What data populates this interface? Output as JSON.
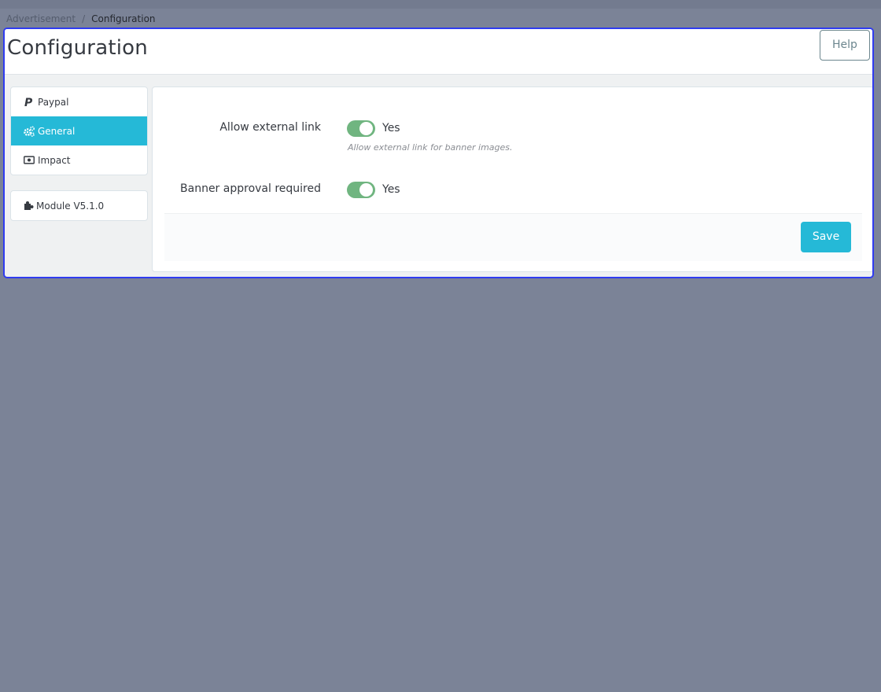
{
  "breadcrumb": {
    "parent": "Advertisement",
    "separator": "/",
    "current": "Configuration"
  },
  "header": {
    "title": "Configuration",
    "help_label": "Help"
  },
  "sidebar": {
    "items": [
      {
        "label": "Paypal",
        "icon": "paypal-icon",
        "active": false
      },
      {
        "label": "General",
        "icon": "cogs-icon",
        "active": true
      },
      {
        "label": "Impact",
        "icon": "money-bill-icon",
        "active": false
      }
    ],
    "module": {
      "label": "Module V5.1.0",
      "icon": "puzzle-icon"
    }
  },
  "form": {
    "fields": [
      {
        "label": "Allow external link",
        "value": "Yes",
        "enabled": true,
        "help": "Allow external link for banner images."
      },
      {
        "label": "Banner approval required",
        "value": "Yes",
        "enabled": true
      }
    ],
    "save_label": "Save"
  },
  "colors": {
    "accent": "#25b9d7",
    "switch_on": "#70b580",
    "frame_border": "#2f3bf0",
    "background": "#7b8397"
  }
}
